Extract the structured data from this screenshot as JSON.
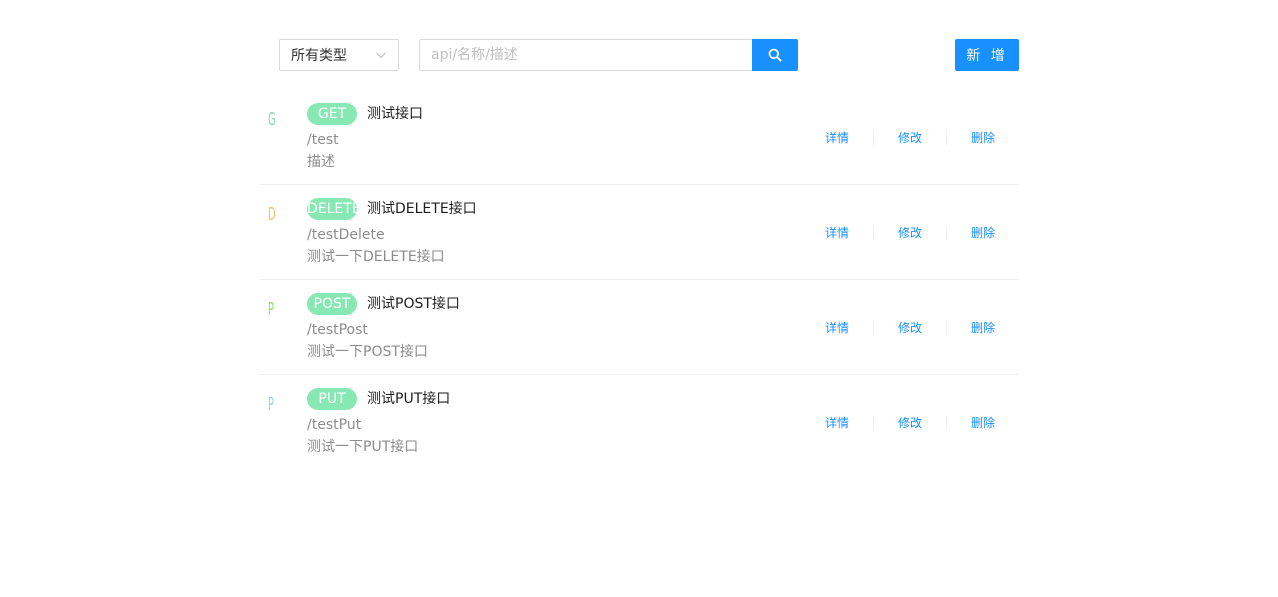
{
  "toolbar": {
    "type_select": {
      "value": "所有类型"
    },
    "search": {
      "placeholder": "api/名称/描述",
      "value": ""
    },
    "add_label": "新 增"
  },
  "colors": {
    "primary": "#1890ff",
    "method_tag_bg": "#87e8b4",
    "GET": "#87d8a8",
    "DELETE": "#ffc069",
    "POST": "#95de64",
    "PUT": "#91d5ff"
  },
  "apis": [
    {
      "initial": "G",
      "method": "GET",
      "name": "测试接口",
      "path": "/test",
      "desc": "描述",
      "initial_color": "#87d8a8"
    },
    {
      "initial": "D",
      "method": "DELETE",
      "name": "测试DELETE接口",
      "path": "/testDelete",
      "desc": "测试一下DELETE接口",
      "initial_color": "#ffc069"
    },
    {
      "initial": "P",
      "method": "POST",
      "name": "测试POST接口",
      "path": "/testPost",
      "desc": "测试一下POST接口",
      "initial_color": "#95de64"
    },
    {
      "initial": "P",
      "method": "PUT",
      "name": "测试PUT接口",
      "path": "/testPut",
      "desc": "测试一下PUT接口",
      "initial_color": "#91d5ff"
    }
  ],
  "actions": {
    "detail": "详情",
    "edit": "修改",
    "delete": "删除"
  },
  "icons": {
    "select_arrow": "chevron-down-icon",
    "search": "search-icon"
  }
}
